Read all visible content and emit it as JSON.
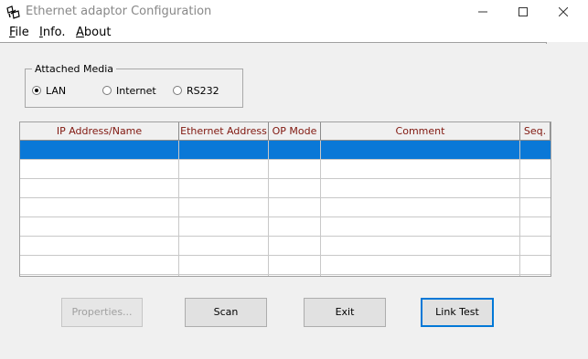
{
  "window": {
    "title": "Ethernet adaptor Configuration"
  },
  "menu": [
    "File",
    "Info.",
    "About"
  ],
  "attached_media": {
    "legend": "Attached Media",
    "options": [
      {
        "label": "LAN",
        "checked": true
      },
      {
        "label": "Internet",
        "checked": false
      },
      {
        "label": "RS232",
        "checked": false
      }
    ]
  },
  "table": {
    "columns": [
      "IP Address/Name",
      "Ethernet Address",
      "OP Mode",
      "Comment",
      "Seq."
    ],
    "rows": [
      {
        "selected": true,
        "cells": [
          "",
          "",
          "",
          "",
          ""
        ]
      },
      {
        "selected": false,
        "cells": [
          "",
          "",
          "",
          "",
          ""
        ]
      },
      {
        "selected": false,
        "cells": [
          "",
          "",
          "",
          "",
          ""
        ]
      },
      {
        "selected": false,
        "cells": [
          "",
          "",
          "",
          "",
          ""
        ]
      },
      {
        "selected": false,
        "cells": [
          "",
          "",
          "",
          "",
          ""
        ]
      },
      {
        "selected": false,
        "cells": [
          "",
          "",
          "",
          "",
          ""
        ]
      },
      {
        "selected": false,
        "cells": [
          "",
          "",
          "",
          "",
          ""
        ]
      }
    ]
  },
  "buttons": {
    "properties": "Properties...",
    "scan": "Scan",
    "exit": "Exit",
    "link_test": "Link Test"
  },
  "colors": {
    "selection": "#0a78d7",
    "header_text": "#80170f",
    "dialog_bg": "#f0f0f0"
  }
}
